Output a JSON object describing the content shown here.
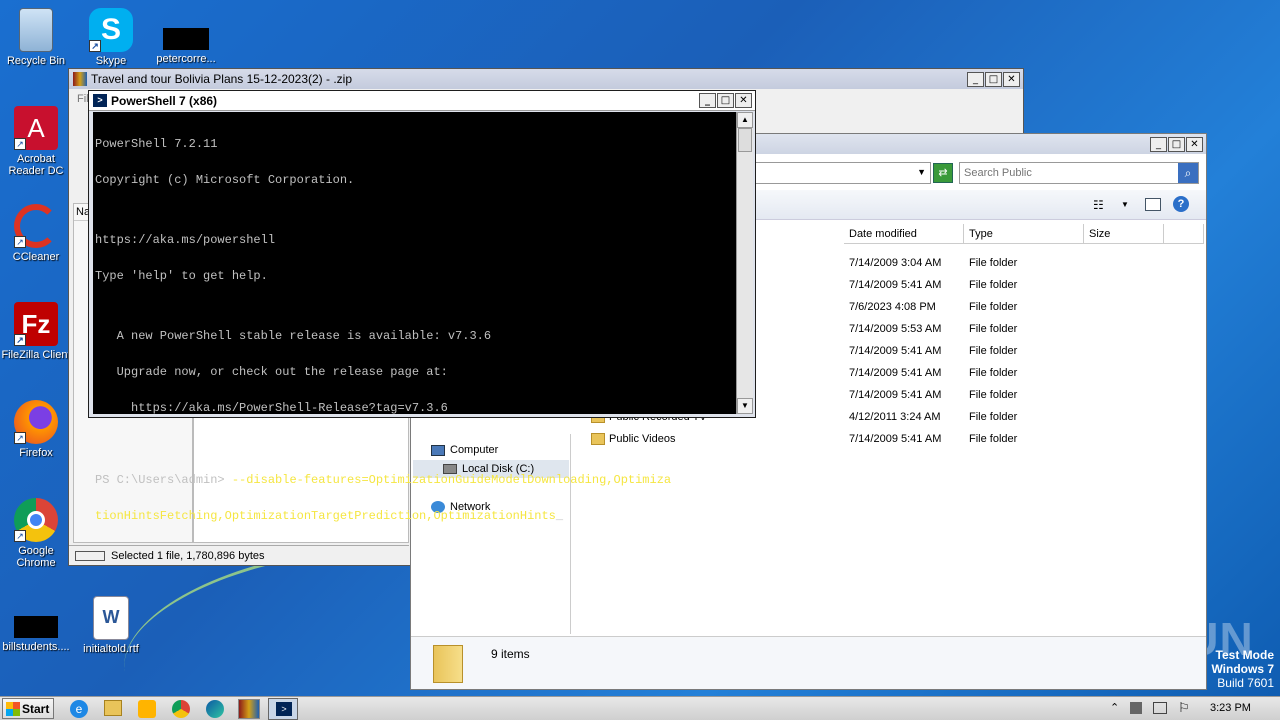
{
  "desktop": {
    "icons": [
      {
        "label": "Recycle Bin"
      },
      {
        "label": "Skype"
      },
      {
        "label": "petercorre..."
      },
      {
        "label": "Acrobat Reader DC"
      },
      {
        "label": "CCleaner"
      },
      {
        "label": "FileZilla Client"
      },
      {
        "label": "Firefox"
      },
      {
        "label": "Google Chrome"
      },
      {
        "label": "billstudents...."
      },
      {
        "label": "initialtold.rtf"
      }
    ],
    "watermark": {
      "brand": "ANY RUN",
      "line1": "Test Mode",
      "line2": "Windows 7",
      "line3": "Build 7601"
    }
  },
  "winrar": {
    "title": "Travel and tour Bolivia  Plans 15-12-2023(2) - .zip",
    "menu_stub": "File",
    "col_stub": "Na",
    "status": "Selected 1 file, 1,780,896 bytes"
  },
  "powershell": {
    "title": "PowerShell 7 (x86)",
    "lines": [
      "PowerShell 7.2.11",
      "Copyright (c) Microsoft Corporation.",
      "",
      "https://aka.ms/powershell",
      "Type 'help' to get help.",
      "",
      "   A new PowerShell stable release is available: v7.3.6",
      "   Upgrade now, or check out the release page at:",
      "     https://aka.ms/PowerShell-Release?tag=v7.3.6",
      ""
    ],
    "prompt": "PS C:\\Users\\admin> ",
    "command_part1": "--disable-features=OptimizationGuideModelDownloading,Optimiza",
    "command_part2": "tionHintsFetching,OptimizationTargetPrediction,OptimizationHints"
  },
  "explorer": {
    "search_placeholder": "Search Public",
    "columns": [
      "Date modified",
      "Type",
      "Size"
    ],
    "rows": [
      {
        "name": "",
        "date": "7/14/2009 3:04 AM",
        "type": "File folder"
      },
      {
        "name": "",
        "date": "7/14/2009 5:41 AM",
        "type": "File folder"
      },
      {
        "name": "",
        "date": "7/6/2023 4:08 PM",
        "type": "File folder"
      },
      {
        "name": "",
        "date": "7/14/2009 5:53 AM",
        "type": "File folder"
      },
      {
        "name": "",
        "date": "7/14/2009 5:41 AM",
        "type": "File folder"
      },
      {
        "name": "",
        "date": "7/14/2009 5:41 AM",
        "type": "File folder"
      },
      {
        "name": "",
        "date": "7/14/2009 5:41 AM",
        "type": "File folder"
      },
      {
        "name": "Public Recorded TV",
        "date": "4/12/2011 3:24 AM",
        "type": "File folder"
      },
      {
        "name": "Public Videos",
        "date": "7/14/2009 5:41 AM",
        "type": "File folder"
      }
    ],
    "nav": {
      "computer": "Computer",
      "local_disk": "Local Disk (C:)",
      "network": "Network"
    },
    "status_items": "9 items"
  },
  "taskbar": {
    "start": "Start",
    "time": "3:23 PM"
  }
}
